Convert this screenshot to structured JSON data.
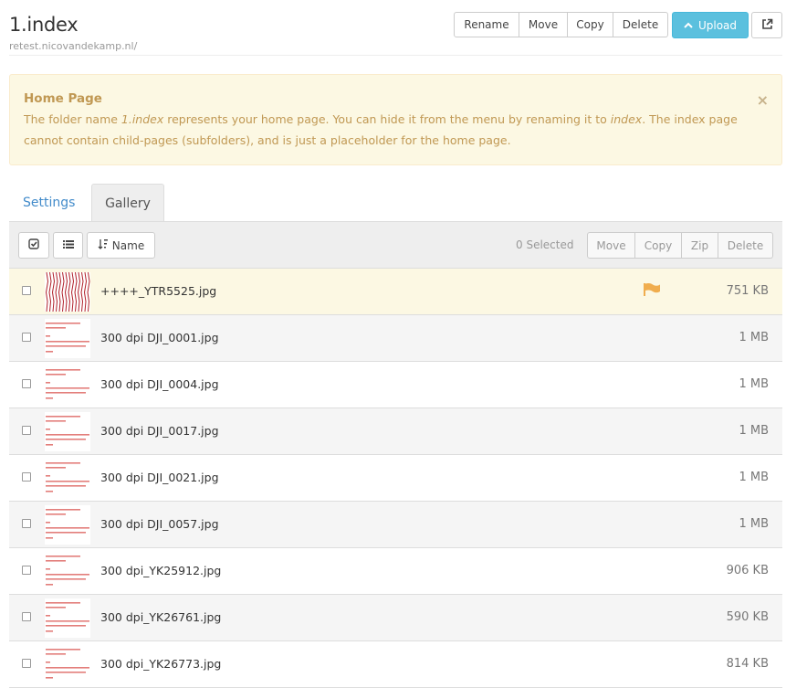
{
  "header": {
    "title": "1.index",
    "subtitle": "retest.nicovandekamp.nl/",
    "buttons": [
      "Rename",
      "Move",
      "Copy",
      "Delete"
    ],
    "upload_label": "Upload",
    "accent": "#5bc0de"
  },
  "alert": {
    "heading": "Home Page",
    "text_1": "The folder name ",
    "em_1": "1.index",
    "text_2": " represents your home page. You can hide it from the menu by renaming it to ",
    "em_2": "index",
    "text_3": ". The index page cannot contain child-pages (subfolders), and is just a placeholder for the home page.",
    "close": "×",
    "color": "#c09853"
  },
  "tabs": {
    "settings": "Settings",
    "gallery": "Gallery"
  },
  "toolbar": {
    "sort_label": "Name",
    "selected_text": "0 Selected",
    "actions": [
      "Move",
      "Copy",
      "Zip",
      "Delete"
    ]
  },
  "files": [
    {
      "name": "++++_YTR5525.jpg",
      "size": "751 KB",
      "flag": true
    },
    {
      "name": "300 dpi DJI_0001.jpg",
      "size": "1 MB",
      "flag": false
    },
    {
      "name": "300 dpi DJI_0004.jpg",
      "size": "1 MB",
      "flag": false
    },
    {
      "name": "300 dpi DJI_0017.jpg",
      "size": "1 MB",
      "flag": false
    },
    {
      "name": "300 dpi DJI_0021.jpg",
      "size": "1 MB",
      "flag": false
    },
    {
      "name": "300 dpi DJI_0057.jpg",
      "size": "1 MB",
      "flag": false
    },
    {
      "name": "300 dpi_YK25912.jpg",
      "size": "906 KB",
      "flag": false
    },
    {
      "name": "300 dpi_YK26761.jpg",
      "size": "590 KB",
      "flag": false
    },
    {
      "name": "300 dpi_YK26773.jpg",
      "size": "814 KB",
      "flag": false
    }
  ]
}
